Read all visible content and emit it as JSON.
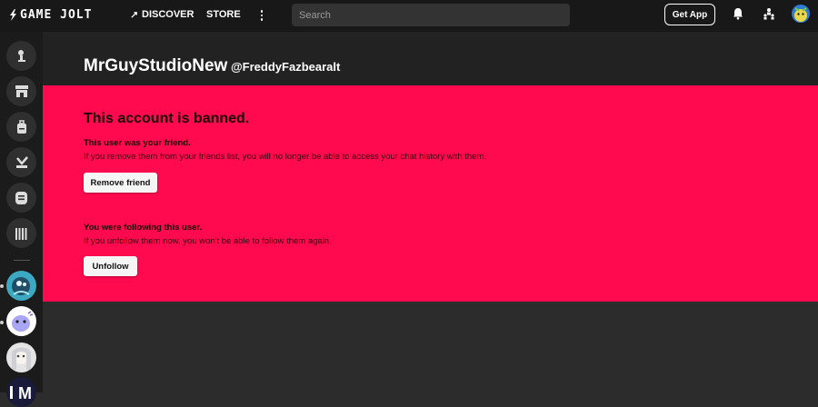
{
  "topbar": {
    "logo_text": "GAME JOLT",
    "discover_label": "DISCOVER",
    "store_label": "STORE",
    "search_placeholder": "Search",
    "get_app_label": "Get App"
  },
  "profile": {
    "display_name": "MrGuyStudioNew",
    "username": "@FreddyFazbearalt"
  },
  "banned": {
    "title": "This account is banned.",
    "friend_heading": "This user was your friend.",
    "friend_text": "If you remove them from your friends list, you will no longer be able to access your chat history with them.",
    "remove_friend_label": "Remove friend",
    "follow_heading": "You were following this user.",
    "follow_text": "If you unfollow them now, you won't be able to follow them again.",
    "unfollow_label": "Unfollow"
  },
  "sidebar": {
    "items": [
      {
        "icon": "realms-icon"
      },
      {
        "icon": "store-icon"
      },
      {
        "icon": "backpack-icon"
      },
      {
        "icon": "trophy-icon"
      },
      {
        "icon": "chat-icon"
      },
      {
        "icon": "library-icon"
      }
    ],
    "partial_avatar_letter": "M"
  },
  "colors": {
    "banned_bg": "#ff0a4f",
    "topbar_bg": "#181818",
    "page_bg": "#2c2c2c"
  }
}
